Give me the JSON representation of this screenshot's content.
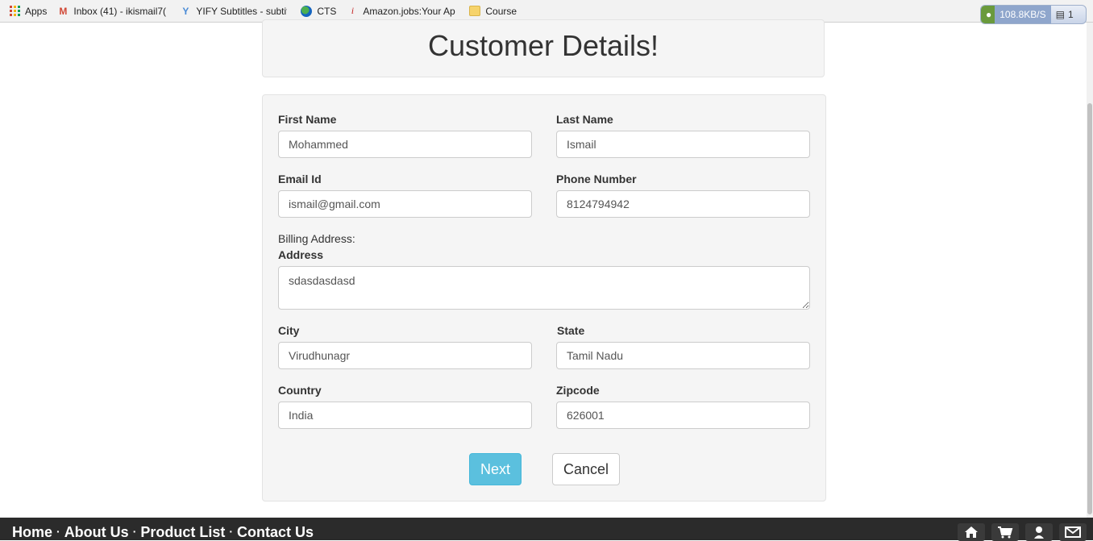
{
  "bookmarks": [
    {
      "label": "Apps",
      "icon": "apps-grid-icon"
    },
    {
      "label": "Inbox (41) - ikismail7(",
      "icon": "gmail-icon"
    },
    {
      "label": "YIFY Subtitles - subtit",
      "icon": "yify-icon"
    },
    {
      "label": "CTS",
      "icon": "globe-icon"
    },
    {
      "label": "Amazon.jobs:Your Ap",
      "icon": "amazon-jobs-icon"
    },
    {
      "label": "Course",
      "icon": "folder-icon"
    }
  ],
  "extension": {
    "speed": "108.8KB/S",
    "count": "1"
  },
  "header": {
    "title": "Customer Details!"
  },
  "form": {
    "first_name": {
      "label": "First Name",
      "value": "Mohammed"
    },
    "last_name": {
      "label": "Last Name",
      "value": "Ismail"
    },
    "email": {
      "label": "Email Id",
      "value": "ismail@gmail.com"
    },
    "phone": {
      "label": "Phone Number",
      "value": "8124794942"
    },
    "billing_heading": "Billing Address:",
    "address": {
      "label": "Address",
      "value": "sdasdasdasd"
    },
    "city": {
      "label": "City",
      "value": "Virudhunagr"
    },
    "state": {
      "label": "State",
      "value": "Tamil Nadu"
    },
    "country": {
      "label": "Country",
      "value": "India"
    },
    "zipcode": {
      "label": "Zipcode",
      "value": "626001"
    },
    "next_label": "Next",
    "cancel_label": "Cancel"
  },
  "footer": {
    "links": [
      "Home",
      "About Us",
      "Product List",
      "Contact Us"
    ],
    "separator": "·",
    "icons": [
      "home-icon",
      "cart-icon",
      "user-icon",
      "mail-icon"
    ]
  },
  "colors": {
    "primary_button": "#5bc0de",
    "footer_bg": "#2b2b2b",
    "panel_bg": "#f5f5f5"
  }
}
